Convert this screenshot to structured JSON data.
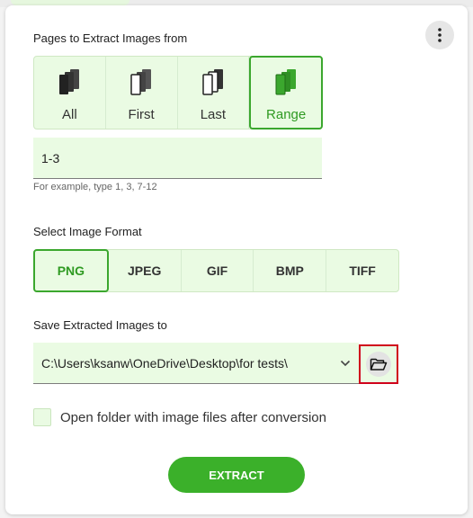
{
  "pages": {
    "label": "Pages to Extract Images from",
    "options": [
      {
        "label": "All",
        "icon": "all-pages-icon",
        "selected": false
      },
      {
        "label": "First",
        "icon": "first-page-icon",
        "selected": false
      },
      {
        "label": "Last",
        "icon": "last-page-icon",
        "selected": false
      },
      {
        "label": "Range",
        "icon": "range-pages-icon",
        "selected": true
      }
    ],
    "range_value": "1-3",
    "hint": "For example, type 1, 3, 7-12"
  },
  "format": {
    "label": "Select Image Format",
    "options": [
      "PNG",
      "JPEG",
      "GIF",
      "BMP",
      "TIFF"
    ],
    "selected": "PNG"
  },
  "save": {
    "label": "Save Extracted Images to",
    "path": "C:\\Users\\ksanw\\OneDrive\\Desktop\\for tests\\",
    "browse_icon": "folder-open-icon"
  },
  "open_folder": {
    "label": "Open folder with image files after conversion",
    "checked": false
  },
  "actions": {
    "extract_label": "EXTRACT",
    "more_icon": "more-vertical-icon"
  },
  "colors": {
    "accent": "#3bb02a",
    "selected_border": "#3ba72e",
    "option_bg": "#eafbe3",
    "highlight": "#d0021b"
  }
}
